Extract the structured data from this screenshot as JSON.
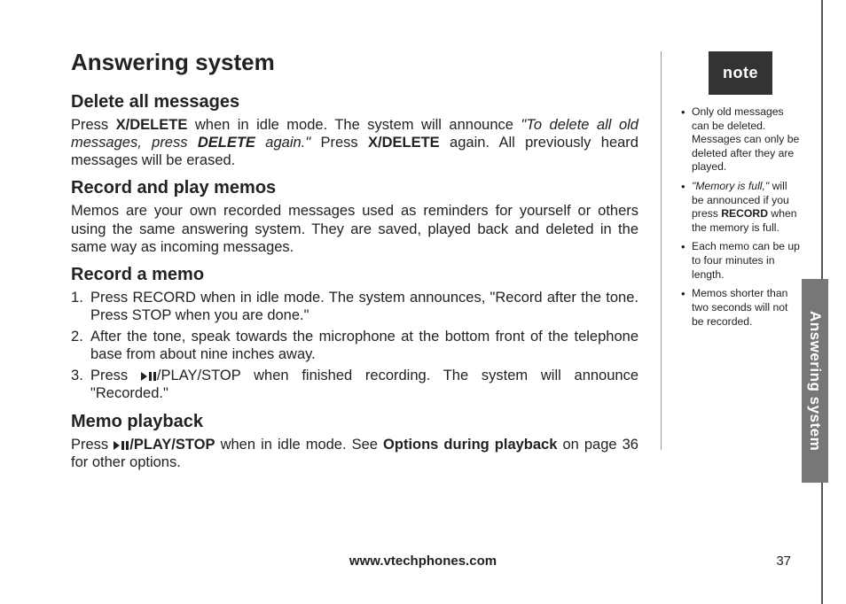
{
  "title": "Answering system",
  "sections": {
    "delete": {
      "heading": "Delete all messages",
      "p1a": "Press ",
      "p1b": "X/DELETE",
      "p1c": " when in idle mode. The system will announce ",
      "p1d": "\"To delete all old messages, press ",
      "p1e": "DELETE",
      "p1f": " again.\"",
      "p1g": " Press ",
      "p1h": "X/DELETE",
      "p1i": " again. All previously heard messages will be erased."
    },
    "recordplay": {
      "heading": "Record and play memos",
      "p": "Memos are your own recorded messages used as reminders for yourself or others using the same answering system. They are saved, played back and deleted in the same way as incoming messages."
    },
    "recordmemo": {
      "heading": "Record a memo",
      "li1a": "Press ",
      "li1b": "RECORD",
      "li1c": " when in idle mode. The system announces, ",
      "li1d": "\"Record after the tone. Press ",
      "li1e": "STOP",
      "li1f": " when you are done.\"",
      "li2": "After the tone, speak towards the microphone at the bottom front of the telephone base from about nine inches away.",
      "li3a": "Press ",
      "li3b": "/",
      "li3c": "PLAY/STOP",
      "li3d": " when finished recording. The system will announce ",
      "li3e": "\"Recorded.\""
    },
    "memoplayback": {
      "heading": "Memo playback",
      "p1a": "Press ",
      "p1b": "/PLAY/STOP",
      "p1c": " when in idle mode. See ",
      "p1d": "Options during playback",
      "p1e": " on page 36 for other options."
    }
  },
  "note": {
    "label": "note",
    "items": {
      "n1": "Only old messages can be deleted. Messages can only be deleted after they are played.",
      "n2a": "\"Memory is full,\"",
      "n2b": " will be announced if you press ",
      "n2c": "RECORD",
      "n2d": " when the memory is full.",
      "n3": "Each memo can be up to four minutes in length.",
      "n4": "Memos shorter than two seconds will not be recorded."
    }
  },
  "sidetab": "Answering system",
  "footer": "www.vtechphones.com",
  "pageNumber": "37"
}
